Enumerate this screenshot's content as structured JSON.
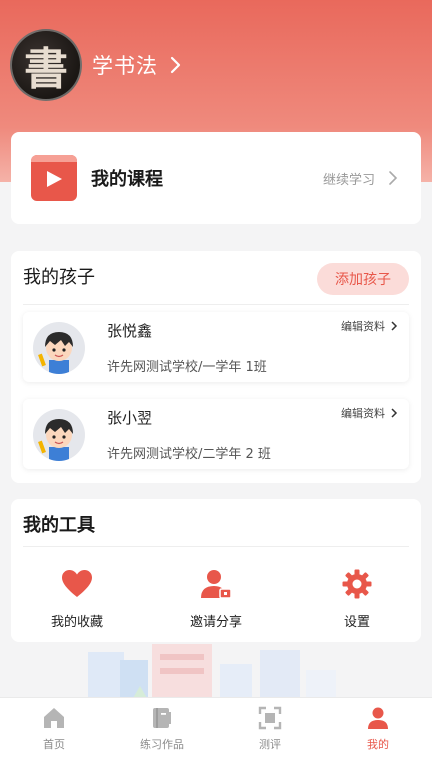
{
  "profile": {
    "avatar_char": "書",
    "name": "学书法"
  },
  "course": {
    "title": "我的课程",
    "cta": "继续学习"
  },
  "kids": {
    "title": "我的孩子",
    "add_label": "添加孩子",
    "children": [
      {
        "name": "张悦鑫",
        "school": "许先网测试学校/一学年 1班",
        "edit_label": "编辑资料"
      },
      {
        "name": "张小翌",
        "school": "许先网测试学校/二学年 2 班",
        "edit_label": "编辑资料"
      }
    ]
  },
  "tools": {
    "title": "我的工具",
    "items": [
      {
        "label": "我的收藏",
        "icon": "heart-icon"
      },
      {
        "label": "邀请分享",
        "icon": "user-share-icon"
      },
      {
        "label": "设置",
        "icon": "gear-icon"
      }
    ]
  },
  "tabbar": {
    "active_index": 3,
    "items": [
      {
        "label": "首页",
        "icon": "home-icon"
      },
      {
        "label": "练习作品",
        "icon": "book-icon"
      },
      {
        "label": "测评",
        "icon": "scan-icon"
      },
      {
        "label": "我的",
        "icon": "person-icon"
      }
    ]
  },
  "colors": {
    "accent": "#e8574a",
    "header": "#ec7466",
    "inactive": "#b5b5b5"
  }
}
